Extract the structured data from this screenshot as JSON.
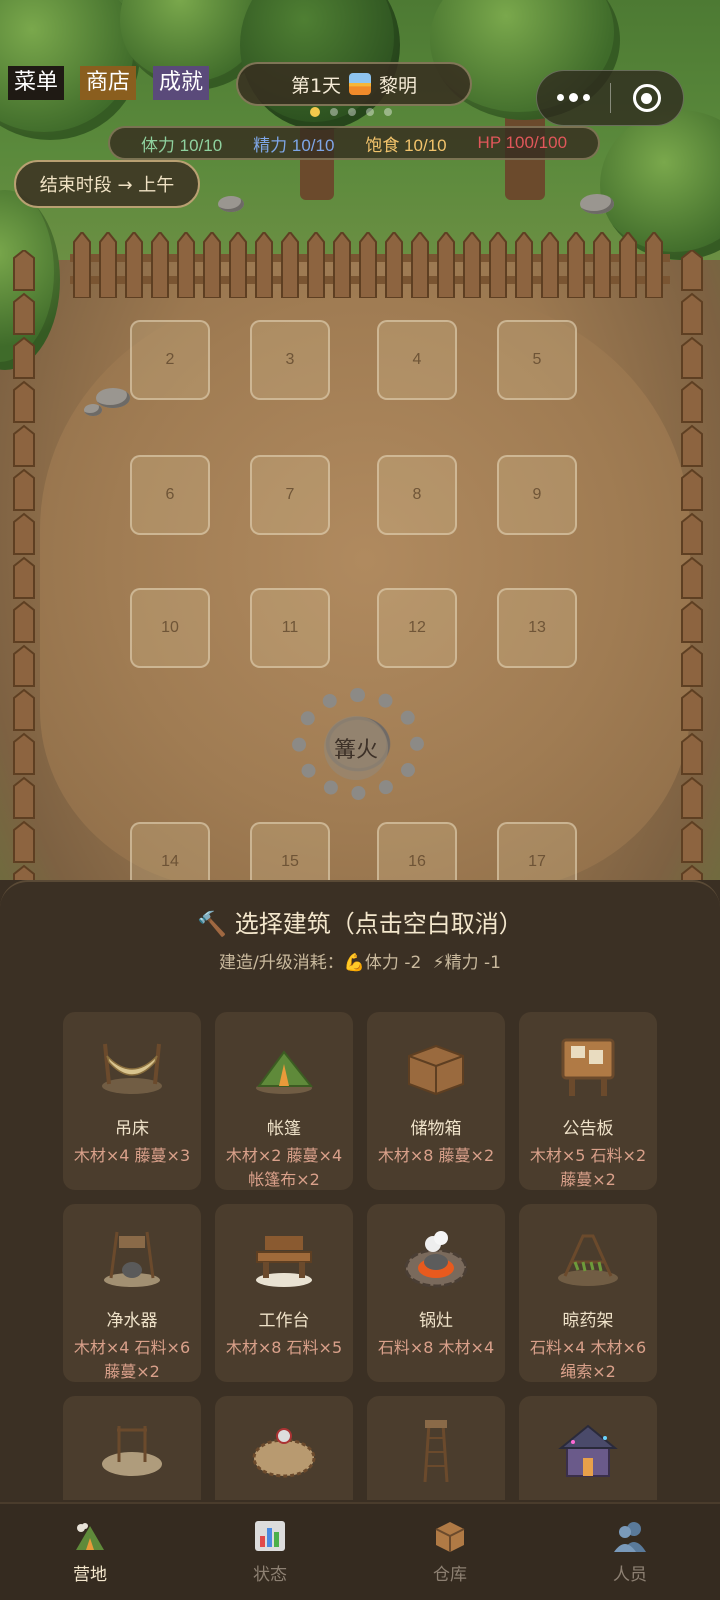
{
  "top": {
    "menu": "菜单",
    "shop": "商店",
    "achievements": "成就",
    "day": "第1天",
    "period": "黎明",
    "stats": [
      {
        "label": "体力 10/10",
        "color": "#8fd19e"
      },
      {
        "label": "精力 10/10",
        "color": "#7ea6e6"
      },
      {
        "label": "饱食 10/10",
        "color": "#f2c36b"
      },
      {
        "label": "HP 100/100",
        "color": "#e0575a"
      }
    ],
    "end_period": "结束时段 → 上午"
  },
  "plots": [
    "2",
    "3",
    "4",
    "5",
    "6",
    "7",
    "8",
    "9",
    "10",
    "11",
    "12",
    "13",
    "14",
    "15",
    "16",
    "17"
  ],
  "campfire": "篝火",
  "sheet": {
    "title": "选择建筑（点击空白取消）",
    "subtitle_prefix": "建造/升级消耗：",
    "cost_stamina": "体力 -2",
    "cost_energy": "精力 -1",
    "buildings": [
      {
        "name": "吊床",
        "cost": "木材×4 藤蔓×3"
      },
      {
        "name": "帐篷",
        "cost": "木材×2 藤蔓×4 帐篷布×2"
      },
      {
        "name": "储物箱",
        "cost": "木材×8 藤蔓×2"
      },
      {
        "name": "公告板",
        "cost": "木材×5 石料×2 藤蔓×2"
      },
      {
        "name": "净水器",
        "cost": "木材×4 石料×6 藤蔓×2"
      },
      {
        "name": "工作台",
        "cost": "木材×8 石料×5"
      },
      {
        "name": "锅灶",
        "cost": "石料×8 木材×4"
      },
      {
        "name": "晾药架",
        "cost": "石料×4 木材×6 绳索×2"
      },
      {
        "name": "",
        "cost": ""
      },
      {
        "name": "",
        "cost": ""
      },
      {
        "name": "",
        "cost": ""
      },
      {
        "name": "",
        "cost": ""
      }
    ]
  },
  "tabs": [
    {
      "label": "营地",
      "active": true
    },
    {
      "label": "状态",
      "active": false
    },
    {
      "label": "仓库",
      "active": false
    },
    {
      "label": "人员",
      "active": false
    }
  ]
}
